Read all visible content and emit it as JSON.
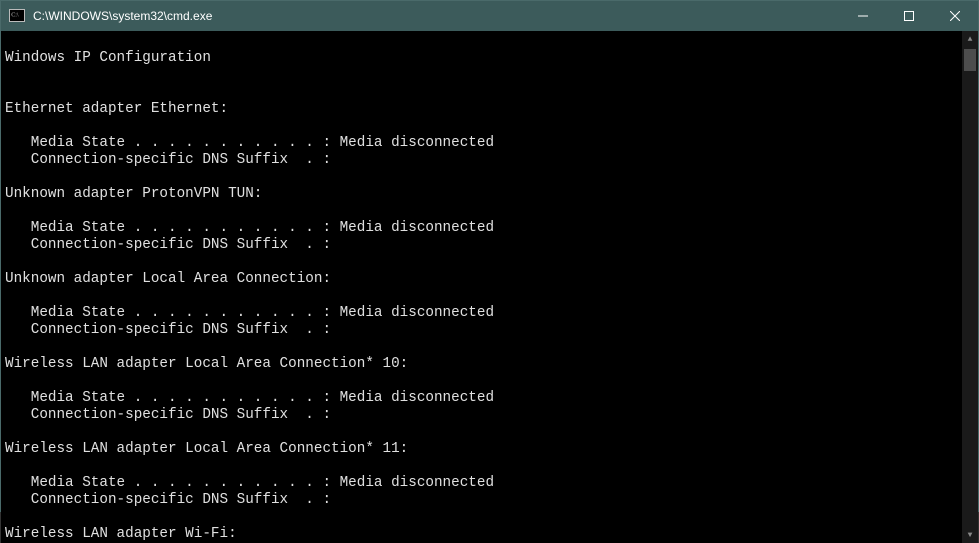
{
  "window": {
    "title": "C:\\WINDOWS\\system32\\cmd.exe"
  },
  "output": {
    "header": "Windows IP Configuration",
    "adapters": [
      {
        "name": "Ethernet adapter Ethernet:",
        "lines": [
          "   Media State . . . . . . . . . . . : Media disconnected",
          "   Connection-specific DNS Suffix  . :"
        ]
      },
      {
        "name": "Unknown adapter ProtonVPN TUN:",
        "lines": [
          "   Media State . . . . . . . . . . . : Media disconnected",
          "   Connection-specific DNS Suffix  . :"
        ]
      },
      {
        "name": "Unknown adapter Local Area Connection:",
        "lines": [
          "   Media State . . . . . . . . . . . : Media disconnected",
          "   Connection-specific DNS Suffix  . :"
        ]
      },
      {
        "name": "Wireless LAN adapter Local Area Connection* 10:",
        "lines": [
          "   Media State . . . . . . . . . . . : Media disconnected",
          "   Connection-specific DNS Suffix  . :"
        ]
      },
      {
        "name": "Wireless LAN adapter Local Area Connection* 11:",
        "lines": [
          "   Media State . . . . . . . . . . . : Media disconnected",
          "   Connection-specific DNS Suffix  . :"
        ]
      },
      {
        "name": "Wireless LAN adapter Wi-Fi:",
        "lines": []
      }
    ]
  }
}
